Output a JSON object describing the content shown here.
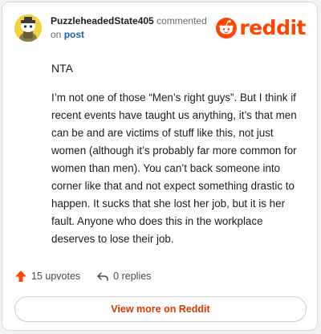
{
  "header": {
    "username": "PuzzleheadedState405",
    "action_text": "commented",
    "on_text": "on",
    "post_link": "post",
    "logo_text": "reddit"
  },
  "comment": {
    "first_line": "NTA",
    "body": "I’m not one of those “Men’s right guys”. But I think if recent events have taught us anything, it’s that men can be and are victims of stuff like this, not just women (although it’s probably far more common for women than men). You can’t back someone into corner like that and not expect something drastic to happen. It sucks that she lost her job, but it is her fault. Anyone who does this in the workplace deserves to lose their job."
  },
  "actions": {
    "upvotes_label": "15 upvotes",
    "replies_label": "0 replies"
  },
  "footer": {
    "view_more_label": "View more on Reddit"
  },
  "colors": {
    "brand": "#ff4500",
    "upvote": "#ff4500",
    "link": "#1a5fb4",
    "view_more_text": "#d93a00",
    "avatar_bg": "#f4d03f"
  },
  "icons": {
    "avatar": "snoo-avatar",
    "logo": "reddit-snoo-icon",
    "upvote": "upvote-arrow-icon",
    "reply": "reply-arrow-icon"
  }
}
